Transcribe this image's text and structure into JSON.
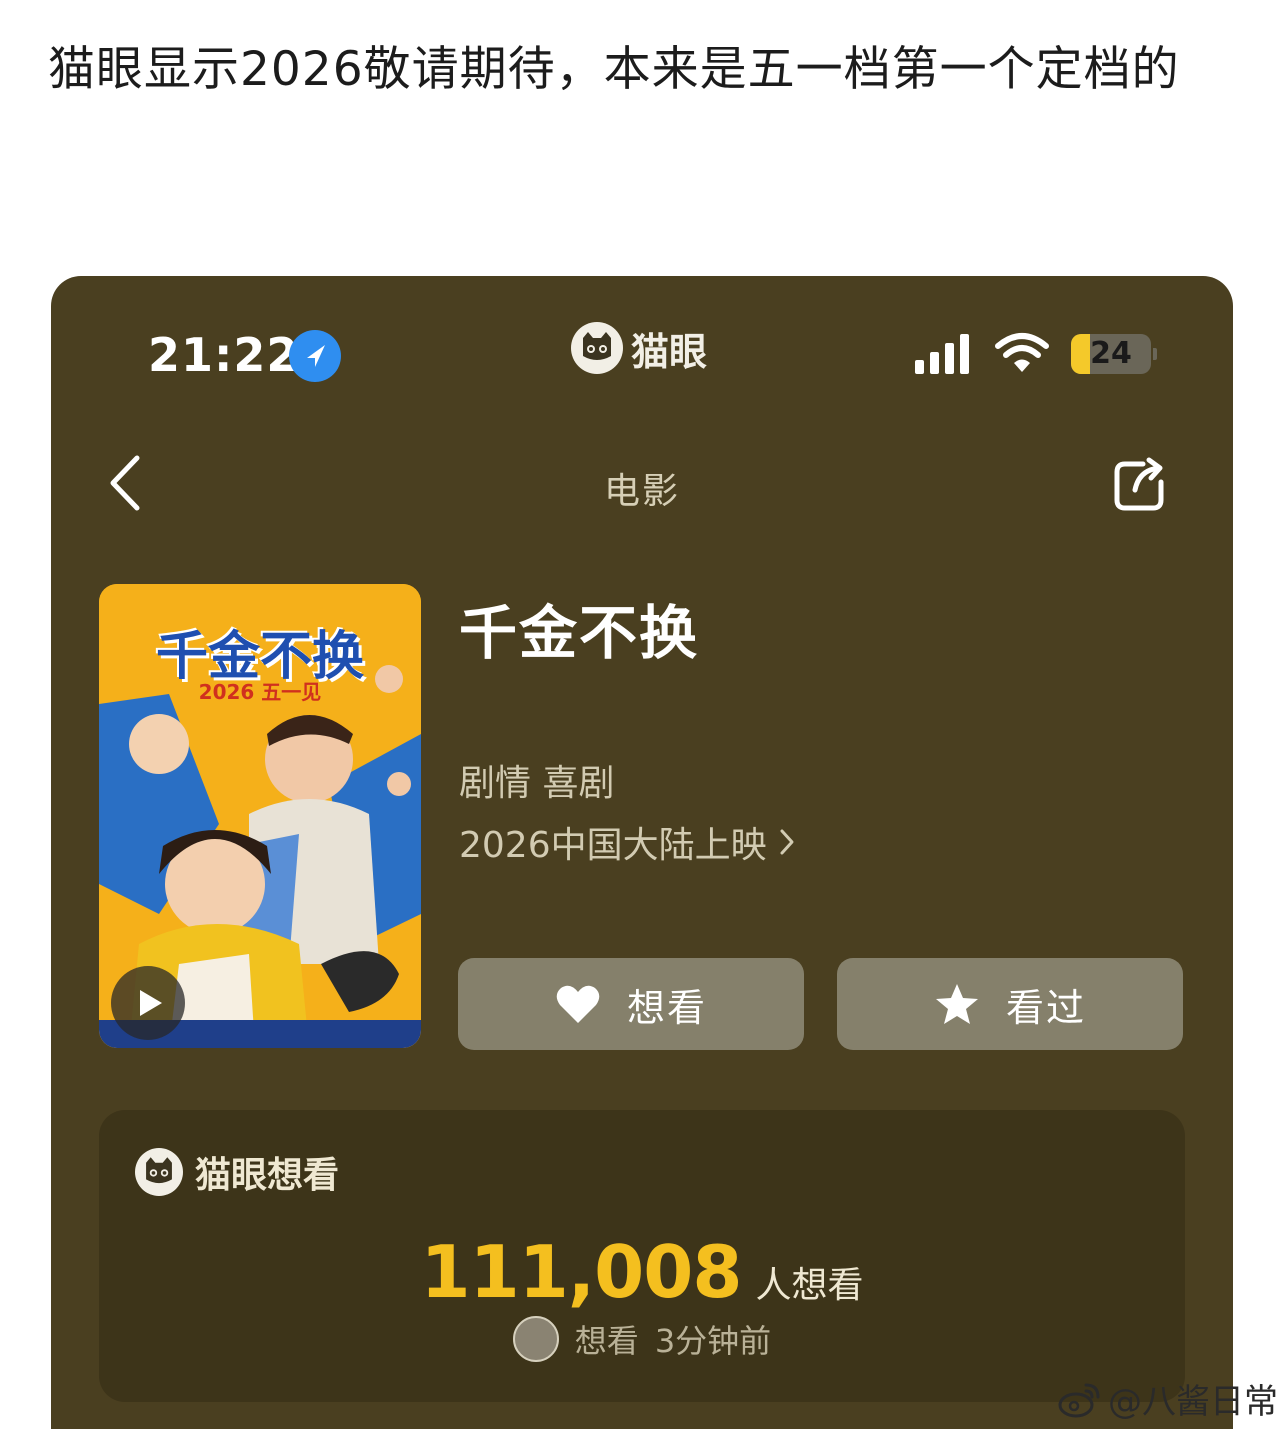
{
  "post": {
    "text": "猫眼显示2026敬请期待，本来是五一档第一个定档的"
  },
  "status_bar": {
    "time": "21:22",
    "battery": "24"
  },
  "app": {
    "brand": "猫眼"
  },
  "nav": {
    "title": "电影"
  },
  "movie": {
    "title": "千金不换",
    "genre": "剧情 喜剧",
    "release": "2026中国大陆上映",
    "poster_title": "千金不换",
    "poster_subtitle": "2026 五一见"
  },
  "actions": {
    "want_label": "想看",
    "seen_label": "看过"
  },
  "stats": {
    "label": "猫眼想看",
    "count": "111,008",
    "unit": "人想看",
    "activity_action": "想看",
    "activity_time": "3分钟前"
  },
  "watermark": {
    "text": "@八酱日常"
  },
  "colors": {
    "background": "#4a3f20",
    "accent": "#f4bf1f",
    "button": "#85806b"
  }
}
